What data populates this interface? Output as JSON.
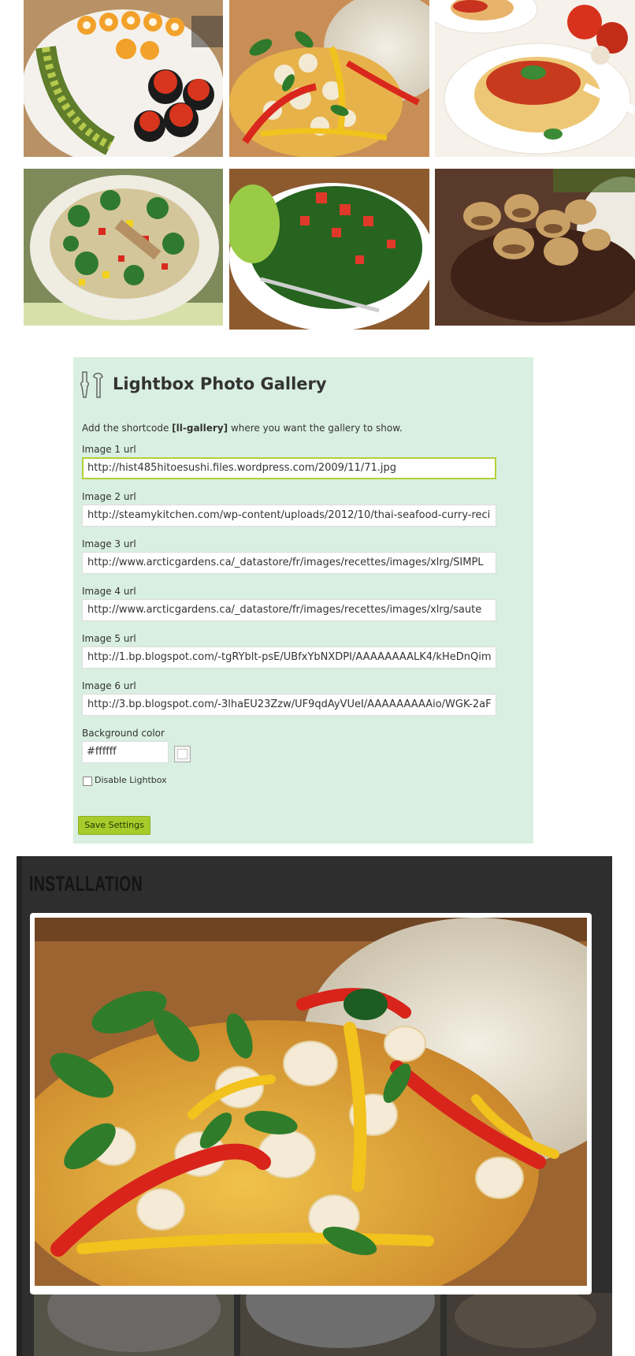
{
  "gallery": {
    "thumbnails": [
      {
        "name": "sushi-platter-photo"
      },
      {
        "name": "seafood-curry-photo"
      },
      {
        "name": "spaghetti-bolognese-photo"
      },
      {
        "name": "vegetable-salad-photo"
      },
      {
        "name": "tabbouleh-salad-photo"
      },
      {
        "name": "steak-mushrooms-photo"
      }
    ]
  },
  "panel": {
    "icon": "tools-icon",
    "title": "Lightbox Photo Gallery",
    "intro_prefix": "Add the shortcode ",
    "shortcode": "[ll-gallery]",
    "intro_suffix": " where you want the gallery to show.",
    "images": [
      {
        "label": "Image 1 url",
        "value": "http://hist485hitoesushi.files.wordpress.com/2009/11/71.jpg"
      },
      {
        "label": "Image 2 url",
        "value": "http://steamykitchen.com/wp-content/uploads/2012/10/thai-seafood-curry-reci"
      },
      {
        "label": "Image 3 url",
        "value": "http://www.arcticgardens.ca/_datastore/fr/images/recettes/images/xlrg/SIMPL"
      },
      {
        "label": "Image 4 url",
        "value": "http://www.arcticgardens.ca/_datastore/fr/images/recettes/images/xlrg/saute"
      },
      {
        "label": "Image 5 url",
        "value": "http://1.bp.blogspot.com/-tgRYblt-psE/UBfxYbNXDPI/AAAAAAAALK4/kHeDnQim"
      },
      {
        "label": "Image 6 url",
        "value": "http://3.bp.blogspot.com/-3lhaEU23Zzw/UF9qdAyVUeI/AAAAAAAAAio/WGK-2aF"
      }
    ],
    "background_label": "Background color",
    "background_value": "#ffffff",
    "disable_lightbox_label": "Disable Lightbox",
    "disable_lightbox_checked": false,
    "save_label": "Save Settings"
  },
  "installation": {
    "title": "INSTALLATION"
  },
  "lightbox": {
    "image": "seafood-curry-photo"
  },
  "colors": {
    "panel_bg": "#d9efe1",
    "active_border": "#b3cf3a",
    "save_button": "#a6cb2b",
    "dark_bg": "#2e2e2e"
  }
}
